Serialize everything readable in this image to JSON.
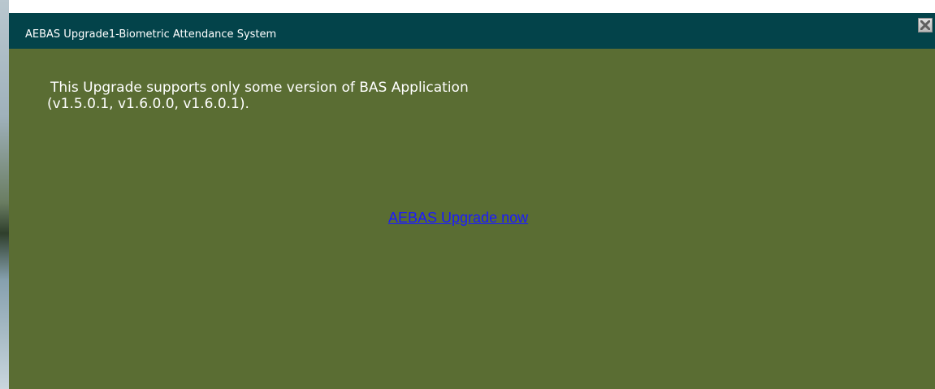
{
  "window": {
    "title": "AEBAS Upgrade1-Biometric Attendance System",
    "close_icon": "close-icon"
  },
  "main": {
    "message_line1": "This Upgrade supports only some version of BAS Application",
    "message_line2": "(v1.5.0.1, v1.6.0.0, v1.6.0.1).",
    "upgrade_link": "AEBAS Upgrade now"
  },
  "colors": {
    "titlebar": "#03434a",
    "body": "#5a6d33",
    "link": "#1a1aff",
    "text": "#ffffff"
  }
}
